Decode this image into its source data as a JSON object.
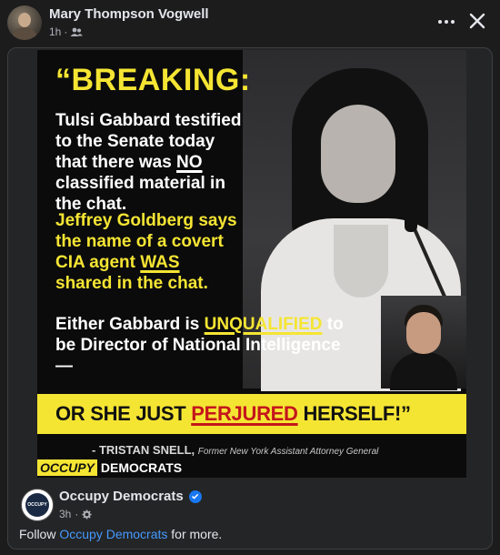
{
  "post": {
    "author": "Mary Thompson Vogwell",
    "time": "1h",
    "privacy_icon": "friends-icon",
    "more_icon": "more-dots-icon",
    "close_icon": "close-icon"
  },
  "image": {
    "breaking": "“BREAKING:",
    "block1": {
      "pre": "Tulsi Gabbard testified to the Senate today that there was ",
      "emph": "NO",
      "post": " classified material in the chat."
    },
    "block2": {
      "pre": "Jeffrey Goldberg says the name of a covert CIA agent ",
      "emph": "WAS",
      "post": " shared in the chat."
    },
    "block3": {
      "pre": "Either Gabbard is ",
      "emph": "UNQUALIFIED",
      "post": " to be Director of National Intelligence —"
    },
    "banner": {
      "pre": "OR SHE JUST ",
      "emph": "PERJURED",
      "post": " HERSELF!”"
    },
    "attribution": "- TRISTAN SNELL,",
    "attribution_sub": "Former New York Assistant Attorney General",
    "brand_a": "OCCUPY",
    "brand_b": "DEMOCRATS",
    "colors": {
      "yellow": "#f5e533",
      "red": "#c4161c"
    }
  },
  "shared": {
    "page_name": "Occupy Democrats",
    "verified_icon": "verified-badge-icon",
    "time": "3h",
    "settings_icon": "gear-icon",
    "avatar_text": "OCCUPY",
    "follow_pre": "Follow ",
    "follow_link": "Occupy Democrats",
    "follow_post": " for more.",
    "link_color": "#4599ff"
  }
}
